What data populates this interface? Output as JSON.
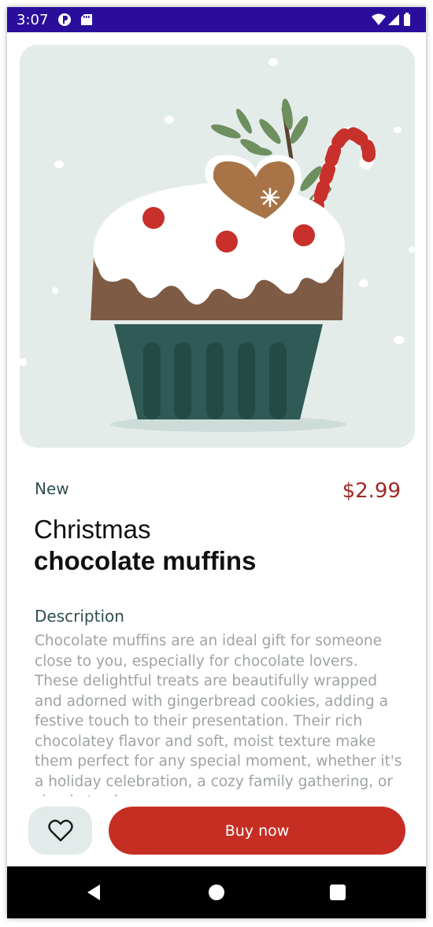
{
  "status_bar": {
    "time": "3:07",
    "background": "#2a0e9b",
    "left_icons": [
      "app-notification-icon",
      "sd-card-icon"
    ],
    "right_icons": [
      "wifi-icon",
      "signal-icon",
      "battery-icon"
    ]
  },
  "product": {
    "image": "christmas-cupcake-illustration",
    "tag": "New",
    "price": "$2.99",
    "title_line1": "Christmas",
    "title_line2": "chocolate muffins",
    "description_heading": "Description",
    "description": "Chocolate muffins are an ideal gift for someone close to you, especially for chocolate lovers. These delightful treats are beautifully wrapped and adorned with gingerbread cookies, adding a festive touch to their presentation. Their rich chocolatey flavor and soft, moist texture make them perfect for any special moment, whether it's a holiday celebration, a cozy family gathering, or simply to share."
  },
  "actions": {
    "favorite_icon": "heart-outline-icon",
    "buy_label": "Buy now"
  },
  "nav_bar": {
    "buttons": [
      "back-icon",
      "home-icon",
      "recents-icon"
    ]
  },
  "colors": {
    "accent": "#c62e24",
    "price": "#a02a24",
    "heading_green": "#2f4f4f",
    "hero_bg": "#e4ecea",
    "fav_bg": "#e2eaea",
    "description_text": "#9ea3a3"
  }
}
